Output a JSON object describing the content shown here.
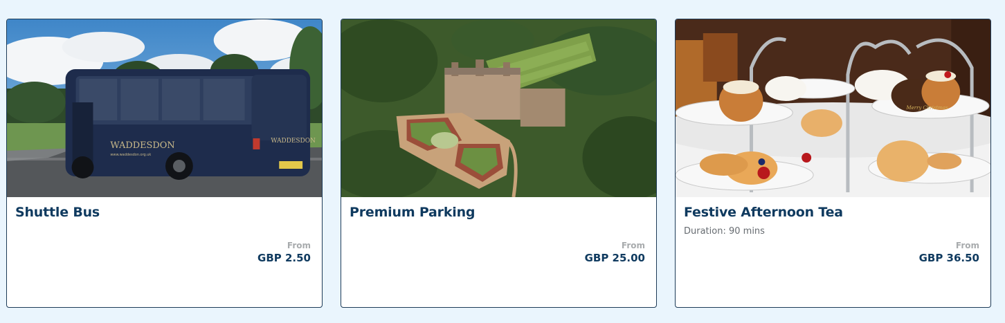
{
  "cards": [
    {
      "title": "Shuttle Bus",
      "duration": "",
      "price_label": "From",
      "price": "GBP 2.50",
      "bus_text": "WADDESDON",
      "bus_url": "www.waddesdon.org.uk"
    },
    {
      "title": "Premium Parking",
      "duration": "",
      "price_label": "From",
      "price": "GBP 25.00"
    },
    {
      "title": "Festive Afternoon Tea",
      "duration": "Duration: 90 mins",
      "price_label": "From",
      "price": "GBP 36.50",
      "cake_text": "Merry Christmas"
    }
  ],
  "colors": {
    "page_background": "#eaf5fd",
    "card_border": "#1c3a57",
    "title": "#0f3a5f",
    "price_label": "#a8abad",
    "duration": "#666b70"
  }
}
